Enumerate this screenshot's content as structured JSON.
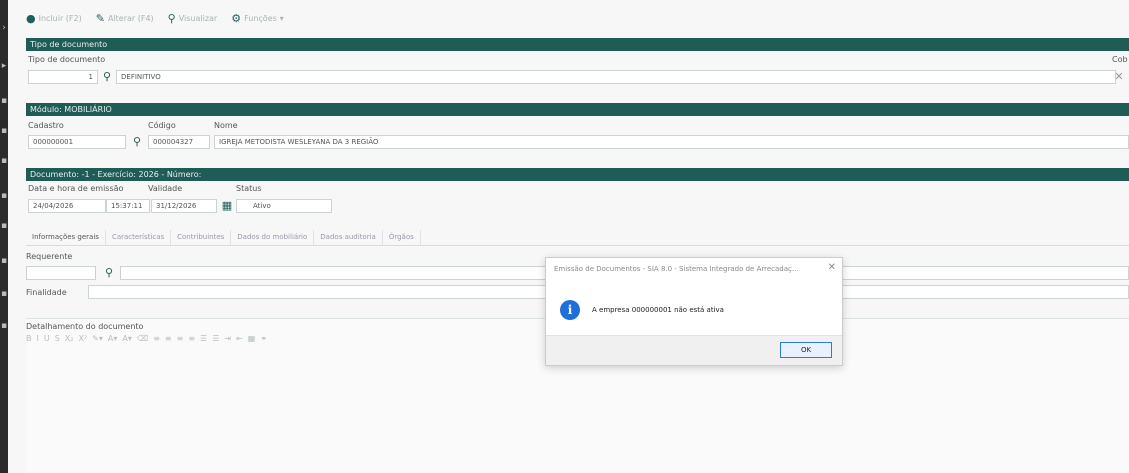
{
  "toolbar": {
    "items": [
      {
        "label": "Incluir (F2)",
        "icon": "plus-circle-icon"
      },
      {
        "label": "Alterar (F4)",
        "icon": "pencil-icon"
      },
      {
        "label": "Visualizar",
        "icon": "search-icon"
      },
      {
        "label": "Funções",
        "icon": "gears-icon"
      }
    ]
  },
  "tipo_documento": {
    "section": "Tipo de documento",
    "label": "Tipo de documento",
    "code": "1",
    "name": "DEFINITIVO",
    "right_label": "Cob"
  },
  "modulo": {
    "section": "Módulo: MOBILIÁRIO",
    "cadastro_label": "Cadastro",
    "cadastro_value": "000000001",
    "codigo_label": "Código",
    "codigo_value": "000004327",
    "nome_label": "Nome",
    "nome_value": "IGREJA METODISTA WESLEYANA DA 3 REGIÃO"
  },
  "documento": {
    "section": "Documento: -1 - Exercício: 2026 - Número:",
    "emissao_label": "Data e hora de emissão",
    "emissao_date": "24/04/2026",
    "emissao_time": "15:37:11",
    "validade_label": "Validade",
    "validade_value": "31/12/2026",
    "status_label": "Status",
    "status_value": "Ativo"
  },
  "tabs": [
    "Informações gerais",
    "Características",
    "Contribuintes",
    "Dados do mobiliário",
    "Dados auditoria",
    "Órgãos"
  ],
  "info": {
    "requerente_label": "Requerente",
    "finalidade_label": "Finalidade",
    "detalhamento_label": "Detalhamento do documento"
  },
  "dialog": {
    "title": "Emissão de Documentos - SIA 8.0 - Sistema Integrado de Arrecadaç...",
    "message": "A empresa 000000001 não está ativa",
    "ok": "OK"
  }
}
